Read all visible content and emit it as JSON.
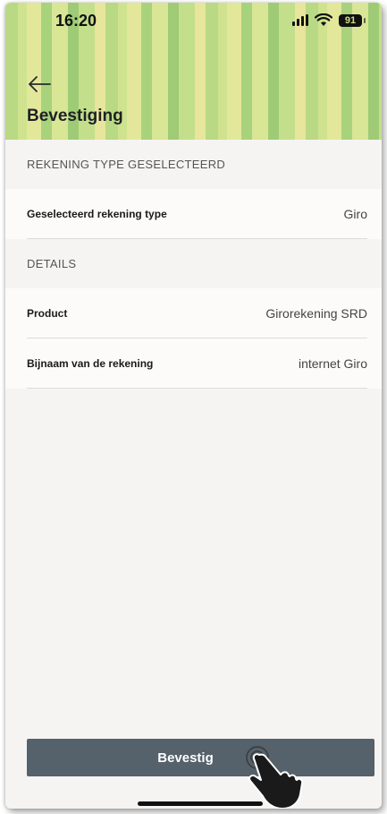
{
  "status_bar": {
    "time": "16:20",
    "battery": "91"
  },
  "header": {
    "back_icon": "arrow-left-icon",
    "title": "Bevestiging"
  },
  "sections": [
    {
      "title": "REKENING TYPE GESELECTEERD",
      "rows": [
        {
          "label": "Geselecteerd rekening type",
          "value": "Giro"
        }
      ]
    },
    {
      "title": "DETAILS",
      "rows": [
        {
          "label": "Product",
          "value": "Girorekening SRD"
        },
        {
          "label": "Bijnaam van de rekening",
          "value": "internet Giro"
        }
      ]
    }
  ],
  "footer": {
    "confirm_label": "Bevestig"
  },
  "colors": {
    "header_green": "#b9d984",
    "button_bg": "#55616b",
    "page_bg": "#f5f4f2"
  }
}
